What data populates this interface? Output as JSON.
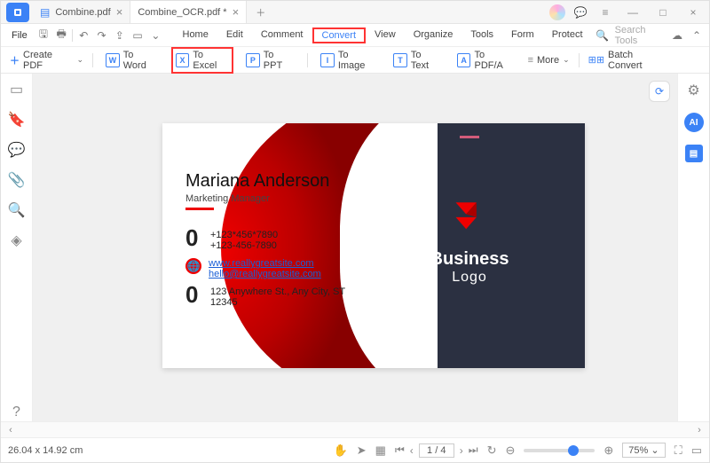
{
  "titlebar": {
    "tabs": [
      {
        "label": "Combine.pdf",
        "active": false
      },
      {
        "label": "Combine_OCR.pdf *",
        "active": true
      }
    ]
  },
  "menubar": {
    "file_label": "File",
    "items": [
      "Home",
      "Edit",
      "Comment",
      "Convert",
      "View",
      "Organize",
      "Tools",
      "Form",
      "Protect"
    ],
    "search_placeholder": "Search Tools"
  },
  "toolbar": {
    "create_pdf": "Create PDF",
    "buttons": [
      {
        "id": "to-word",
        "glyph": "W",
        "label": "To Word"
      },
      {
        "id": "to-excel",
        "glyph": "X",
        "label": "To Excel"
      },
      {
        "id": "to-ppt",
        "glyph": "P",
        "label": "To PPT"
      },
      {
        "id": "to-image",
        "glyph": "I",
        "label": "To Image"
      },
      {
        "id": "to-text",
        "glyph": "T",
        "label": "To Text"
      },
      {
        "id": "to-pdfa",
        "glyph": "A",
        "label": "To PDF/A"
      }
    ],
    "more_label": "More",
    "batch_label": "Batch Convert"
  },
  "right_rail": {
    "ai_label": "AI"
  },
  "card": {
    "name": "Mariana Anderson",
    "role": "Marketing Manager",
    "phone1": "+123*456*7890",
    "phone2": "+123-456-7890",
    "site": "www.reallygreatsite.com",
    "email": "hello@reallygreatsite.com",
    "address1": "123 Anywhere St., Any City, ST",
    "address2": "12345",
    "logo_line1": "Business",
    "logo_line2": "Logo",
    "zero": "0"
  },
  "statusbar": {
    "dimensions": "26.04 x 14.92 cm",
    "page_current": "1",
    "page_total": "/ 4",
    "zoom_percent": "75%"
  },
  "colors": {
    "accent": "#3b82f6",
    "highlight_border": "#f33",
    "brand_red": "#e00",
    "brand_navy": "#2b3041"
  }
}
